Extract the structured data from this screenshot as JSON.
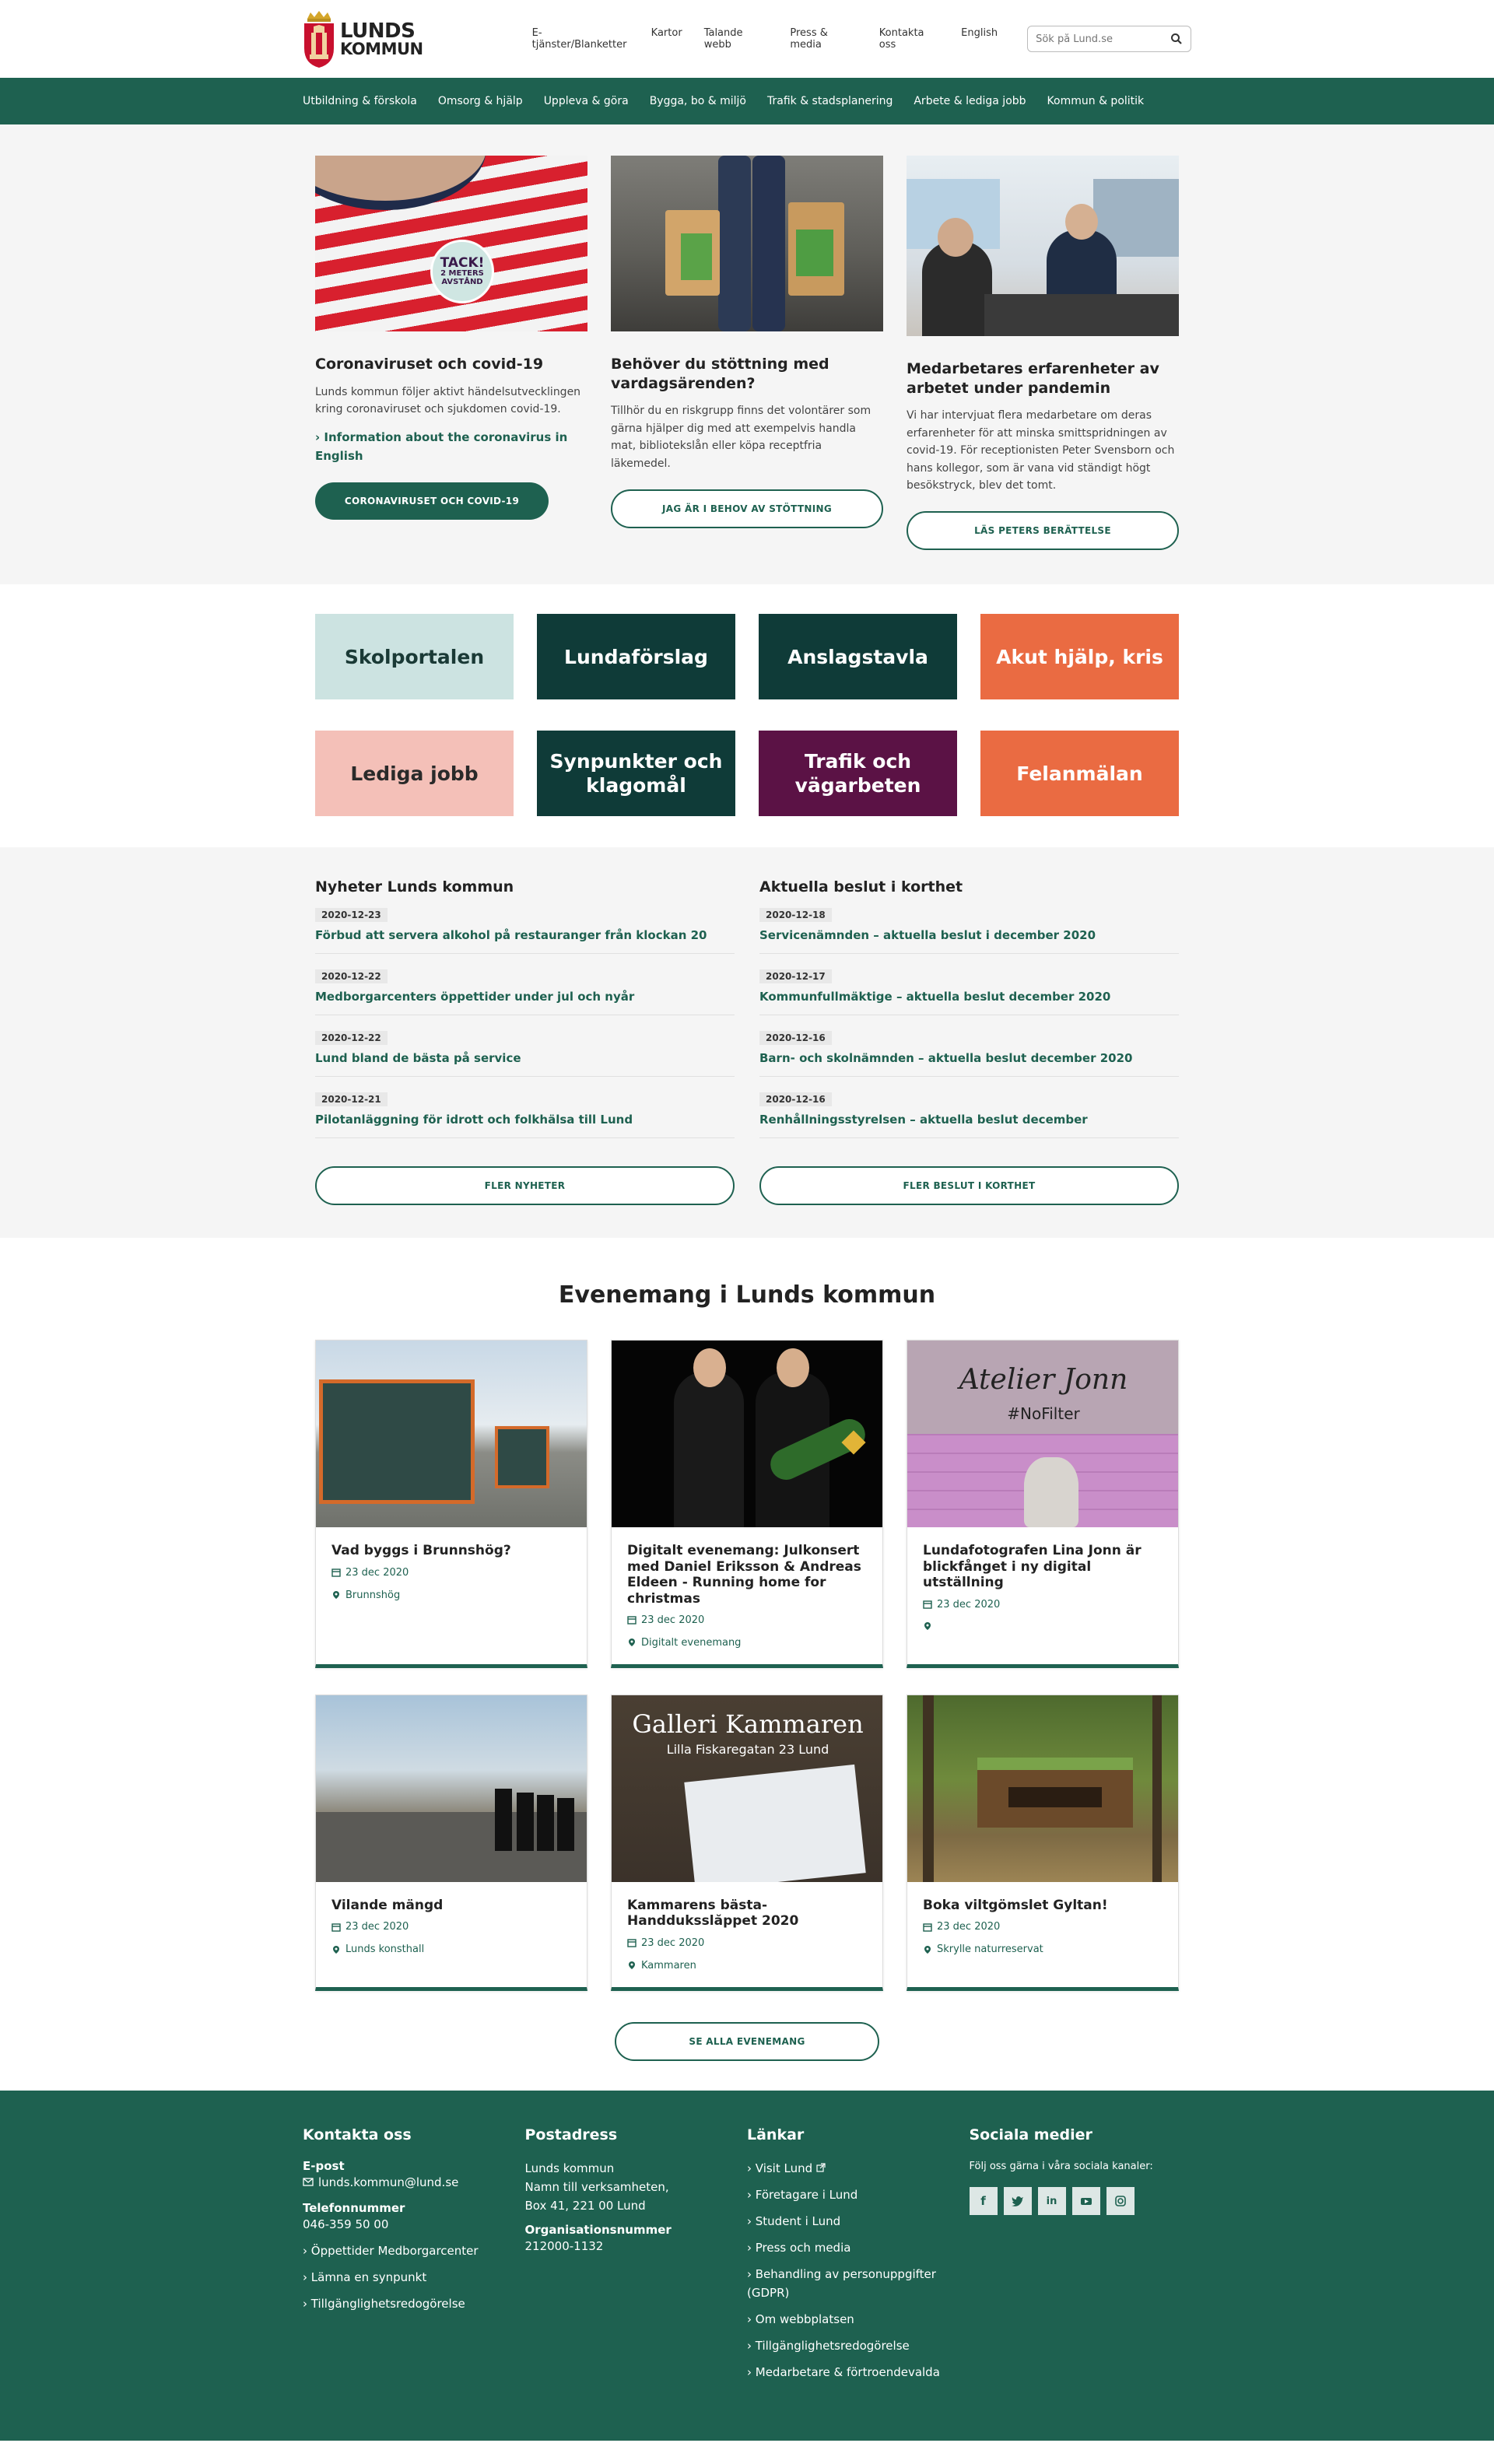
{
  "header": {
    "logo_line1": "LUNDS",
    "logo_line2": "KOMMUN",
    "top_links": [
      "E-tjänster/Blanketter",
      "Kartor",
      "Talande webb",
      "Press & media",
      "Kontakta oss",
      "English"
    ],
    "search_placeholder": "Sök på Lund.se"
  },
  "nav": [
    "Utbildning & förskola",
    "Omsorg & hjälp",
    "Uppleva & göra",
    "Bygga, bo & miljö",
    "Trafik & stadsplanering",
    "Arbete & lediga jobb",
    "Kommun & politik"
  ],
  "hero": [
    {
      "title": "Coronaviruset och covid-19",
      "text": "Lunds kommun följer aktivt händelsutvecklingen kring coronaviruset och sjukdomen covid-19.",
      "link": "› Information about the coronavirus in English",
      "button": "CORONAVIRUSET OCH COVID-19",
      "badge": [
        "TACK!",
        "2 METERS",
        "AVSTÅND"
      ]
    },
    {
      "title": "Behöver du stöttning med vardagsärenden?",
      "text": "Tillhör du en riskgrupp finns det volontärer som gärna hjälper dig med att exempelvis handla mat, bibliotekslån eller köpa receptfria läkemedel.",
      "button": "JAG ÄR I BEHOV AV STÖTTNING"
    },
    {
      "title": "Medarbetares erfarenheter av arbetet under pandemin",
      "text": "Vi har intervjuat flera medarbetare om deras erfarenheter för att minska smittspridningen av covid-19. För receptionisten Peter Svensborn och hans kollegor, som är vana vid ständigt högt besökstryck, blev det tomt.",
      "button": "LÄS PETERS BERÄTTELSE"
    }
  ],
  "tiles": [
    {
      "label": "Skolportalen",
      "bg": "#cce3e1",
      "fg": "#1a3a36"
    },
    {
      "label": "Lundaförslag",
      "bg": "#0f3b38",
      "fg": "#ffffff"
    },
    {
      "label": "Anslagstavla",
      "bg": "#0f3b38",
      "fg": "#ffffff"
    },
    {
      "label": "Akut hjälp, kris",
      "bg": "#ea6b42",
      "fg": "#ffffff"
    },
    {
      "label": "Lediga jobb",
      "bg": "#f4c0b8",
      "fg": "#2a2a2a"
    },
    {
      "label": "Synpunkter och klagomål",
      "bg": "#0f3b38",
      "fg": "#ffffff"
    },
    {
      "label": "Trafik och vägarbeten",
      "bg": "#5b1245",
      "fg": "#ffffff"
    },
    {
      "label": "Felanmälan",
      "bg": "#ea6b42",
      "fg": "#ffffff"
    }
  ],
  "news": {
    "left_title": "Nyheter Lunds kommun",
    "left_items": [
      {
        "date": "2020-12-23",
        "title": "Förbud att servera alkohol på restauranger från klockan 20"
      },
      {
        "date": "2020-12-22",
        "title": "Medborgarcenters öppettider under jul och nyår"
      },
      {
        "date": "2020-12-22",
        "title": "Lund bland de bästa på service"
      },
      {
        "date": "2020-12-21",
        "title": "Pilotanläggning för idrott och folkhälsa till Lund"
      }
    ],
    "left_button": "FLER NYHETER",
    "right_title": "Aktuella beslut i korthet",
    "right_items": [
      {
        "date": "2020-12-18",
        "title": "Servicenämnden – aktuella beslut i december 2020"
      },
      {
        "date": "2020-12-17",
        "title": "Kommunfullmäktige – aktuella beslut december 2020"
      },
      {
        "date": "2020-12-16",
        "title": "Barn- och skolnämnden – aktuella beslut december 2020"
      },
      {
        "date": "2020-12-16",
        "title": "Renhållningsstyrelsen – aktuella beslut december"
      }
    ],
    "right_button": "FLER BESLUT I KORTHET"
  },
  "events": {
    "title": "Evenemang i Lunds kommun",
    "items": [
      {
        "title": "Vad byggs i Brunnshög?",
        "date": "23 dec 2020",
        "place": "Brunnshög"
      },
      {
        "title": "Digitalt evenemang: Julkonsert med Daniel Eriksson & Andreas Eldeen - Running home for christmas",
        "date": "23 dec 2020",
        "place": "Digitalt evenemang"
      },
      {
        "title": "Lundafotografen Lina Jonn är blickfånget i ny digital utställning",
        "date": "23 dec 2020",
        "place": ""
      },
      {
        "title": "Vilande mängd",
        "date": "23 dec 2020",
        "place": "Lunds konsthall"
      },
      {
        "title": "Kammarens bästa-Handduksslăppet 2020",
        "date": "23 dec 2020",
        "place": "Kammaren"
      },
      {
        "title": "Boka viltgömslet Gyltan!",
        "date": "23 dec 2020",
        "place": "Skrylle naturreservat"
      }
    ],
    "img_text_atelier": "Atelier Jonn",
    "img_text_nofilter": "#NoFilter",
    "img_text_galleri": "Galleri Kammaren",
    "img_text_galleri_sub": "Lilla Fiskaregatan 23 Lund",
    "button": "SE ALLA EVENEMANG"
  },
  "footer": {
    "contact_title": "Kontakta oss",
    "email_label": "E-post",
    "email": "lunds.kommun@lund.se",
    "phone_label": "Telefonnummer",
    "phone": "046-359 50 00",
    "contact_links": [
      "› Öppettider Medborgarcenter",
      "› Lämna en synpunkt",
      "› Tillgänglighetsredogörelse"
    ],
    "post_title": "Postadress",
    "post_lines": [
      "Lunds kommun",
      "Namn till verksamheten,",
      "Box 41, 221 00 Lund"
    ],
    "org_label": "Organisationsnummer",
    "org": "212000-1132",
    "links_title": "Länkar",
    "links": [
      "› Visit Lund",
      "› Företagare i Lund",
      "› Student i Lund",
      "› Press och media",
      "› Behandling av personuppgifter (GDPR)",
      "› Om webbplatsen",
      "› Tillgänglighetsredogörelse",
      "› Medarbetare & förtroendevalda"
    ],
    "social_title": "Sociala medier",
    "social_text": "Följ oss gärna i våra sociala kanaler:",
    "social_icons": [
      "f",
      "t",
      "in",
      "yt",
      "ig"
    ]
  },
  "colors": {
    "brand": "#1e6150",
    "page_bg": "#f5f5f5"
  }
}
